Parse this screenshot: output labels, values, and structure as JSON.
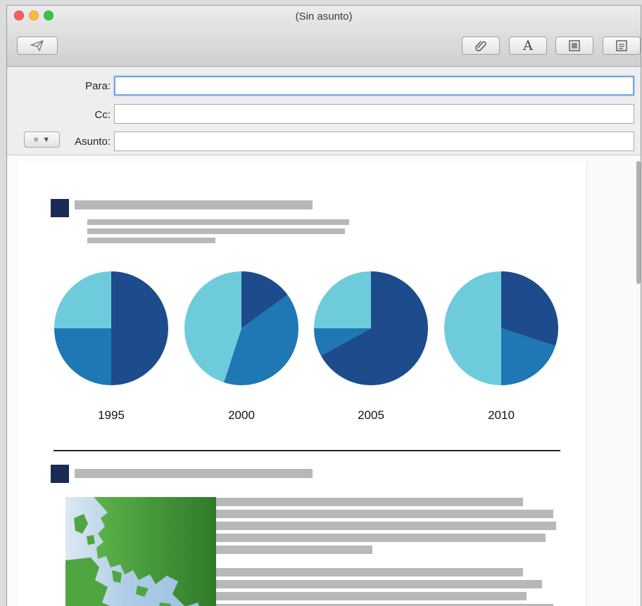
{
  "window": {
    "title": "(Sin asunto)"
  },
  "toolbar": {
    "send_icon": "paper-plane-icon",
    "attach_icon": "paperclip-icon",
    "format_label": "A",
    "photo_icon": "photo-browser-icon",
    "stationery_icon": "stationery-icon"
  },
  "headers": {
    "to_label": "Para:",
    "cc_label": "Cc:",
    "subject_label": "Asunto:",
    "to_value": "",
    "cc_value": "",
    "subject_value": "",
    "menu_icon": "list-icon"
  },
  "colors": {
    "dark_blue": "#1d4b8c",
    "mid_blue": "#1f77b4",
    "light_blue": "#6ecbdc",
    "heading_square": "#1c2b55",
    "map_green": "#3f9e35"
  },
  "chart_data": {
    "type": "pie",
    "charts": [
      {
        "title": "1995",
        "slices": [
          50,
          25,
          25
        ]
      },
      {
        "title": "2000",
        "slices": [
          15,
          40,
          45
        ]
      },
      {
        "title": "2005",
        "slices": [
          67,
          8,
          25
        ]
      },
      {
        "title": "2010",
        "slices": [
          30,
          20,
          50
        ]
      }
    ]
  }
}
